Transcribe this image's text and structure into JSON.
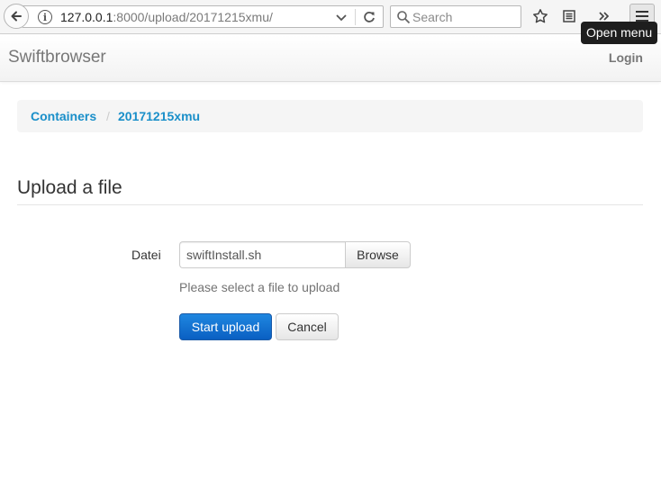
{
  "browser": {
    "url_host": "127.0.0.1",
    "url_rest": ":8000/upload/20171215xmu/",
    "search_placeholder": "Search",
    "tooltip": "Open menu",
    "icons": {
      "back": "arrow-left-icon",
      "info": "info-icon",
      "dropdown": "chevron-down-icon",
      "reload": "reload-icon",
      "search": "search-icon",
      "bookmark": "star-icon",
      "reader": "library-icon",
      "overflow": "double-chevron-icon",
      "menu": "hamburger-icon"
    }
  },
  "navbar": {
    "brand": "Swiftbrowser",
    "login": "Login"
  },
  "breadcrumb": {
    "items": [
      "Containers",
      "20171215xmu"
    ],
    "separator": "/"
  },
  "page": {
    "title": "Upload a file"
  },
  "form": {
    "file_label": "Datei",
    "file_value": "swiftInstall.sh",
    "browse_label": "Browse",
    "help_text": "Please select a file to upload",
    "submit_label": "Start upload",
    "cancel_label": "Cancel"
  },
  "colors": {
    "link": "#1a8fc9",
    "primary_button": "#0a5fc2"
  }
}
